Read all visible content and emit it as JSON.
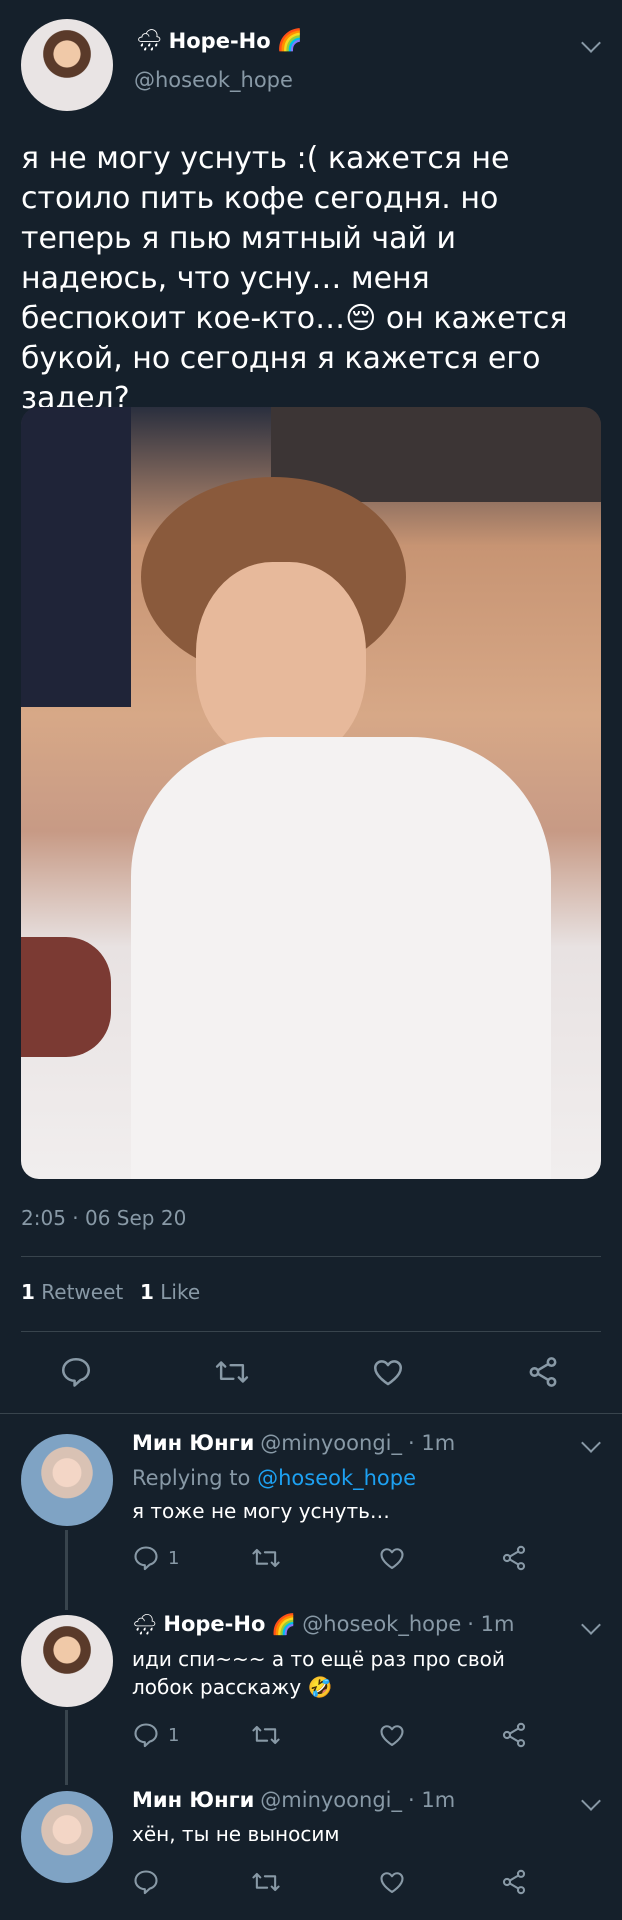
{
  "main_tweet": {
    "name": "Hope-Ho",
    "handle": "@hoseok_hope",
    "weather_emoji": "🌧",
    "rainbow_emoji": "🌈",
    "text": "я не могу уснуть :( кажется не стоило пить кофе сегодня. но теперь я пью мятный чай и надеюсь, что усну… меня беспокоит кое-кто…😔 он кажется букой, но сегодня я кажется его задел?",
    "timestamp": "2:05 · 06 Sep 20",
    "retweets_count": "1",
    "retweets_label": "Retweet",
    "likes_count": "1",
    "likes_label": "Like"
  },
  "replies": [
    {
      "name": "Мин Юнги",
      "handle": "@minyoongi_",
      "time": "· 1m",
      "replying_prefix": "Replying to",
      "replying_to": "@hoseok_hope",
      "text": "я тоже не могу уснуть…",
      "reply_count": "1"
    },
    {
      "weather_emoji": "🌧",
      "name": "Hope-Ho",
      "rainbow_emoji": "🌈",
      "handle": "@hoseok_hope",
      "time": "· 1m",
      "text": "иди спи~~~ а то ещё раз про свой лобок расскажу 🤣",
      "reply_count": "1"
    },
    {
      "name": "Мин Юнги",
      "handle": "@minyoongi_",
      "time": "· 1m",
      "text": "хён, ты не выносим"
    }
  ],
  "colors": {
    "background": "#15202b",
    "divider": "#38444d",
    "muted": "#8899a6",
    "link": "#1da1f2"
  },
  "icons": [
    "reply-icon",
    "retweet-icon",
    "like-icon",
    "share-icon",
    "chevron-down-icon"
  ]
}
